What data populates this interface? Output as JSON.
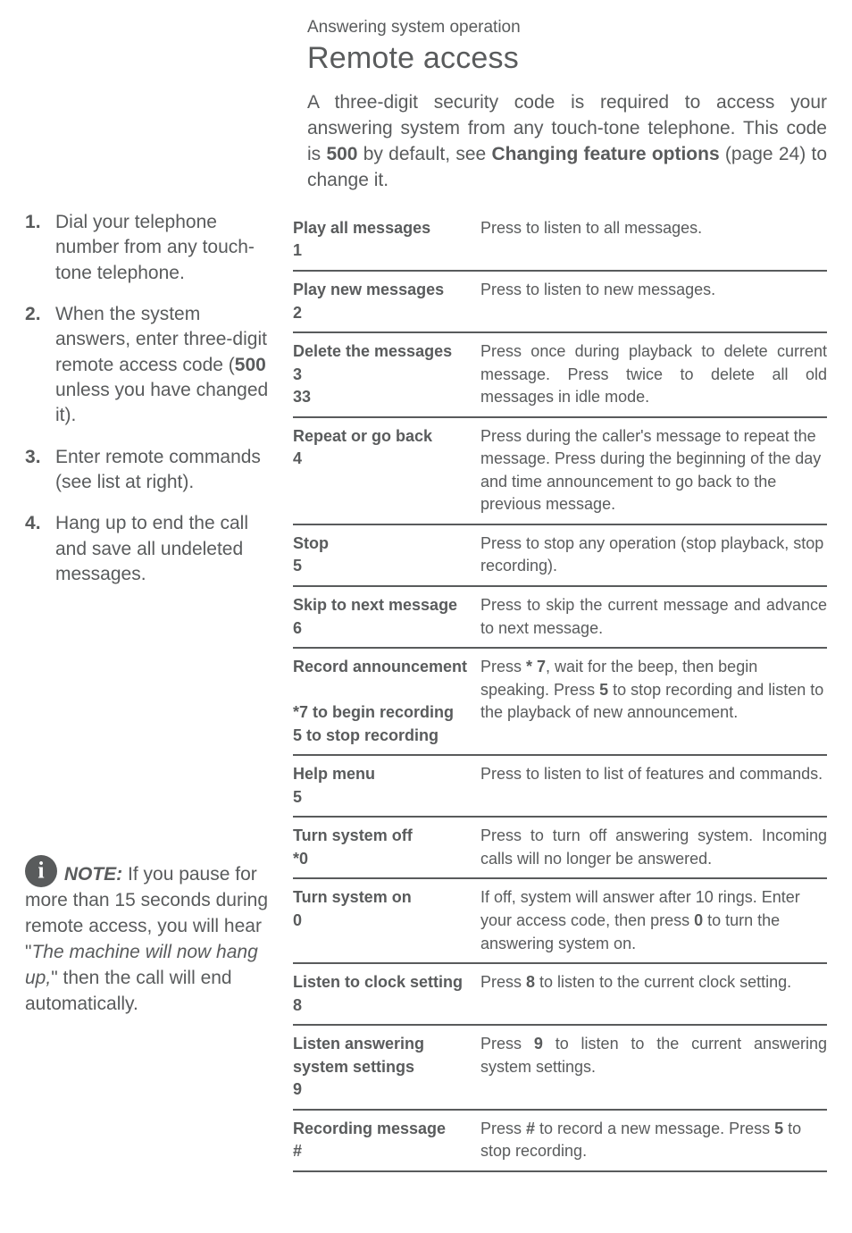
{
  "header": {
    "breadcrumb": "Answering system operation",
    "title": "Remote access",
    "intro_pre": "A three-digit security code is required to access your answering system from any touch-tone telephone. This code is ",
    "intro_code": "500",
    "intro_mid": " by default, see ",
    "intro_link": "Changing feature options",
    "intro_post": " (page 24) to change it."
  },
  "steps": [
    {
      "text": "Dial your telephone number from any touch-tone telephone."
    },
    {
      "pre": "When the system answers, enter three-digit remote access code (",
      "bold": "500",
      "post": " unless you have changed it)."
    },
    {
      "text": "Enter remote com­mands (see list at right)."
    },
    {
      "text": "Hang up to end the call and save all undeleted messages."
    }
  ],
  "note": {
    "label": "NOTE:",
    "pre": " If you pause for more than 15 seconds during remote access, you will hear \"",
    "italic": "The machine will now hang up,",
    "post": "\" then the call will end automati­cally."
  },
  "rows": [
    {
      "k1": "Play all messages",
      "k2": "1",
      "v": "Press to listen to all messages."
    },
    {
      "k1": "Play new messages",
      "k2": "2",
      "v": "Press to listen to new messages."
    },
    {
      "k1": "Delete the messages",
      "k2": "3",
      "k3": "33",
      "v": "Press once during playback to delete current message. Press twice to delete all old messages in idle mode.",
      "justify": true
    },
    {
      "k1": "Repeat or go back",
      "k2": "4",
      "v": "Press during the caller's message to repeat the message. Press during the beginning of the day and time announcement to go back to the previous message."
    },
    {
      "k1": "Stop",
      "k2": "5",
      "v": "Press to stop any operation (stop playback, stop recording)."
    },
    {
      "k1": "Skip to next message",
      "k2": "6",
      "v": "Press to skip the current message and advance to next message.",
      "justify": true
    },
    {
      "k1": "Record announcement",
      "k2_blank": true,
      "k3": "*7 to begin recording",
      "k4": "5 to stop recording",
      "v_parts": [
        {
          "t": "Press "
        },
        {
          "b": "* 7"
        },
        {
          "t": ", wait for the beep, then begin speaking. Press "
        },
        {
          "b": "5"
        },
        {
          "t": " to stop recording and listen to the play­back of new announcement."
        }
      ]
    },
    {
      "k1": "Help menu",
      "k2": "5",
      "v": "Press to listen to list of features and commands.",
      "justify": true
    },
    {
      "k1": "Turn system off",
      "k2": "*0",
      "v": "Press to turn off answering sys­tem. Incoming calls will no longer be answered.",
      "justify": true
    },
    {
      "k1": "Turn system on",
      "k2": "0",
      "v_parts": [
        {
          "t": "If off, system will answer after 10 rings. Enter your access code, then press "
        },
        {
          "b": "0"
        },
        {
          "t": " to turn the answering sys­tem on."
        }
      ]
    },
    {
      "k1": "Listen to clock setting",
      "k2": "8",
      "v_parts": [
        {
          "t": "Press "
        },
        {
          "b": "8"
        },
        {
          "t": " to listen to the current clock setting."
        }
      ],
      "justify": true
    },
    {
      "k1": "Listen answering system settings",
      "k2_inline": true,
      "k3": "9",
      "v_parts": [
        {
          "t": "Press "
        },
        {
          "b": "9"
        },
        {
          "t": " to listen to the current answering system settings."
        }
      ],
      "justify": true
    },
    {
      "k1": "Recording message",
      "k2": "#",
      "v_parts": [
        {
          "t": "Press "
        },
        {
          "b": "#"
        },
        {
          "t": " to record a new message. Press "
        },
        {
          "b": "5"
        },
        {
          "t": " to stop recording."
        }
      ]
    }
  ]
}
